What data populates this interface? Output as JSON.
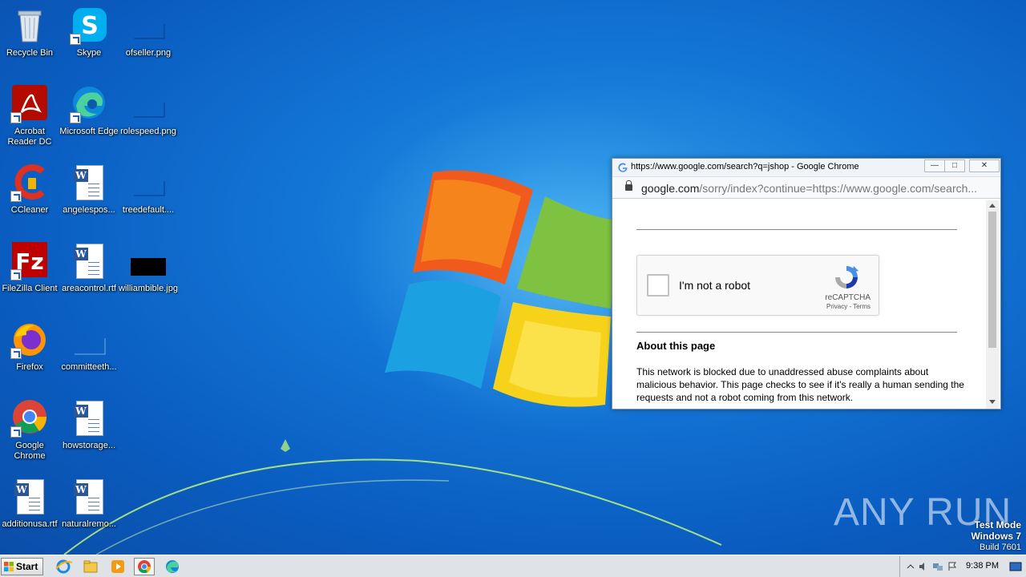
{
  "desktop": {
    "icons": [
      {
        "label": "Recycle Bin",
        "icon": "recycle-bin-icon"
      },
      {
        "label": "Skype",
        "icon": "skype-icon"
      },
      {
        "label": "ofseller.png",
        "icon": "image-file-icon"
      },
      {
        "label": "Acrobat Reader DC",
        "icon": "acrobat-icon"
      },
      {
        "label": "Microsoft Edge",
        "icon": "edge-icon"
      },
      {
        "label": "rolespeed.png",
        "icon": "image-file-icon"
      },
      {
        "label": "CCleaner",
        "icon": "ccleaner-icon"
      },
      {
        "label": "angelespos...",
        "icon": "word-doc-icon"
      },
      {
        "label": "treedefault....",
        "icon": "image-file-icon"
      },
      {
        "label": "FileZilla Client",
        "icon": "filezilla-icon"
      },
      {
        "label": "areacontrol.rtf",
        "icon": "word-doc-icon"
      },
      {
        "label": "williambible.jpg",
        "icon": "image-file-icon"
      },
      {
        "label": "Firefox",
        "icon": "firefox-icon"
      },
      {
        "label": "committeeth...",
        "icon": "file-icon"
      },
      {
        "label": "Google Chrome",
        "icon": "chrome-icon"
      },
      {
        "label": "howstorage...",
        "icon": "word-doc-icon"
      },
      {
        "label": "additionusa.rtf",
        "icon": "word-doc-icon"
      },
      {
        "label": "naturalremo...",
        "icon": "word-doc-icon"
      }
    ],
    "watermark": "ANY RUN",
    "test_mode": {
      "line1": "Test Mode",
      "line2": "Windows 7",
      "line3": "Build 7601"
    }
  },
  "chrome_popup": {
    "title": "https://www.google.com/search?q=jshop - Google Chrome",
    "url_host": "google.com",
    "url_rest": "/sorry/index?continue=https://www.google.com/search...",
    "captcha": {
      "checkbox_label": "I'm not a robot",
      "brand": "reCAPTCHA",
      "privacy": "Privacy",
      "separator": " - ",
      "terms": "Terms"
    },
    "about_heading": "About this page",
    "about_text": "This network is blocked due to unaddressed abuse complaints about malicious behavior. This page checks to see if it's really a human sending the requests and not a robot coming from this network."
  },
  "taskbar": {
    "start_label": "Start",
    "clock": "9:38 PM"
  },
  "colors": {
    "desktop_bg": "#1376d6",
    "taskbar_bg": "#dfe3e8",
    "recaptcha_blue": "#4a90e2"
  }
}
